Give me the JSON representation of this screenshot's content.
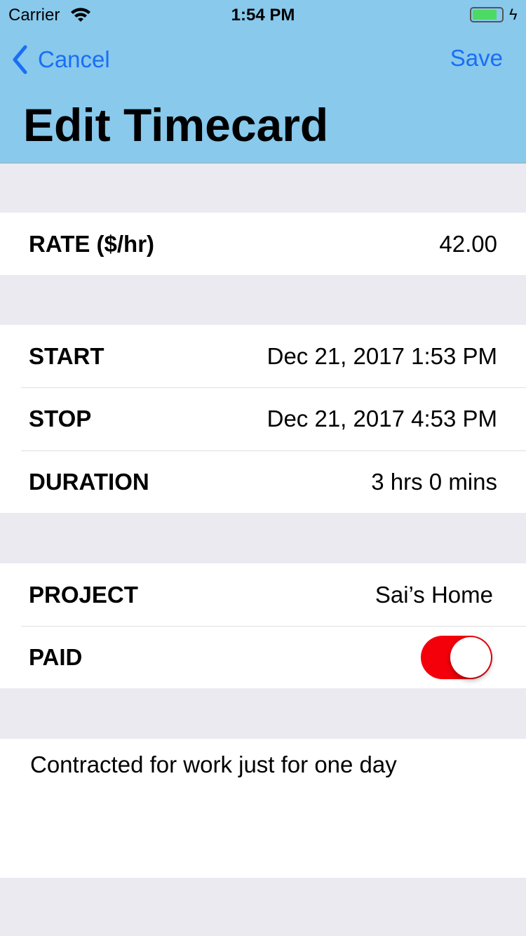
{
  "status_bar": {
    "carrier": "Carrier",
    "time": "1:54 PM"
  },
  "nav": {
    "cancel": "Cancel",
    "save": "Save",
    "title": "Edit Timecard"
  },
  "rate": {
    "label": "RATE ($/hr)",
    "value": "42.00"
  },
  "times": [
    {
      "label": "START",
      "value": "Dec 21, 2017 1:53 PM"
    },
    {
      "label": "STOP",
      "value": "Dec 21, 2017 4:53 PM"
    },
    {
      "label": "DURATION",
      "value": "3 hrs 0 mins"
    }
  ],
  "project": {
    "label": "PROJECT",
    "value": "Sai’s Home"
  },
  "paid": {
    "label": "PAID",
    "on": true
  },
  "notes": "Contracted for work just for one day",
  "colors": {
    "nav_bg": "#88c9ec",
    "accent": "#1a6ef5",
    "toggle_on": "#f4000a"
  }
}
